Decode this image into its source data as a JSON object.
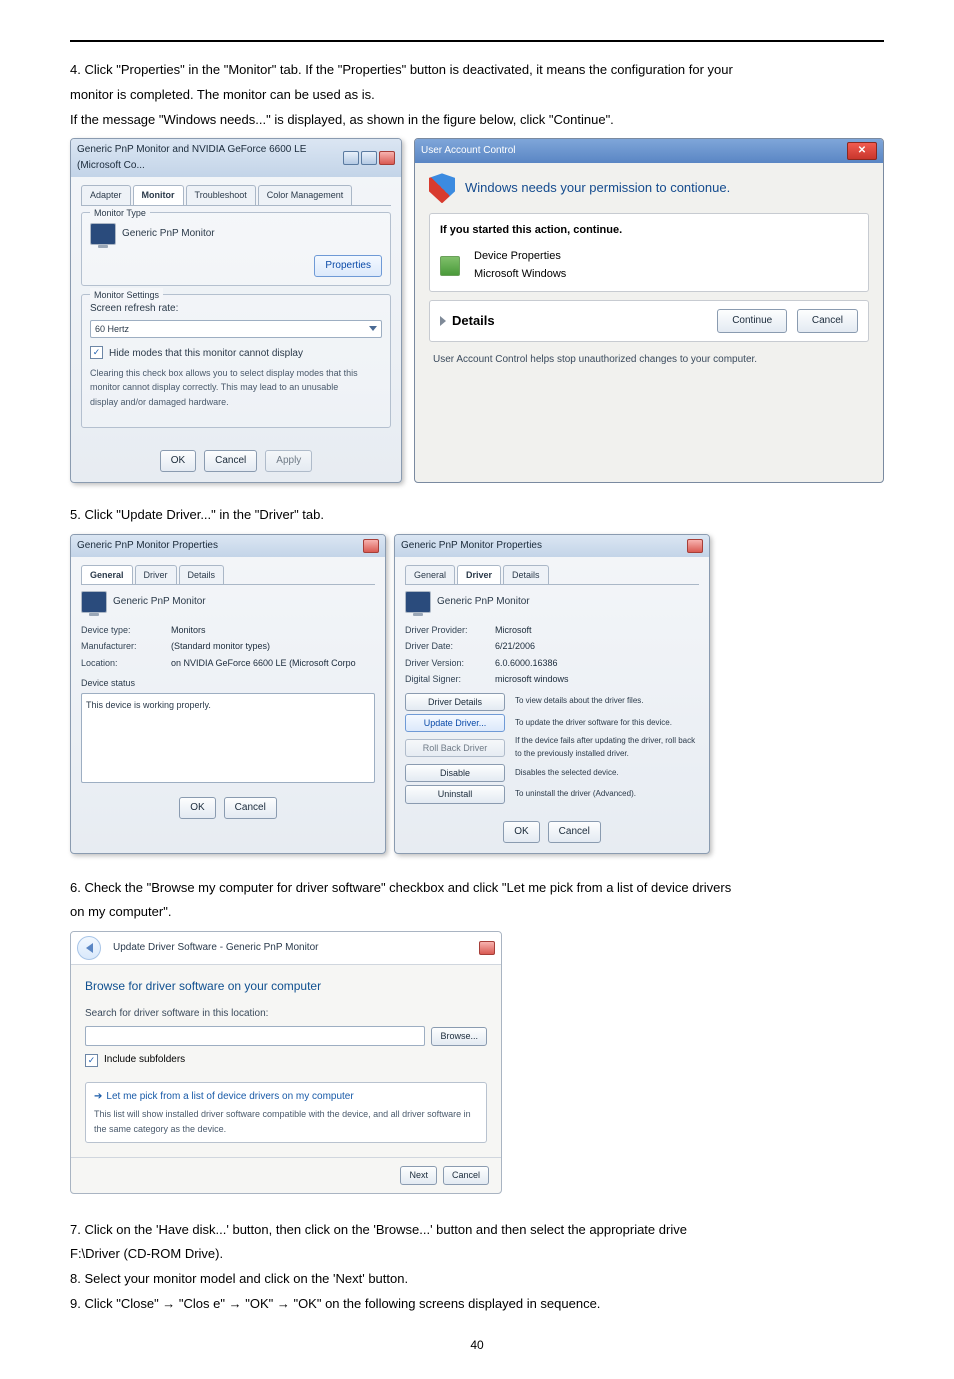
{
  "step4": {
    "line1": "4. Click \"Properties\" in the \"Monitor\" tab. If the \"Properties\" button is deactivated, it means the configuration for your",
    "line2": "monitor is completed. The monitor can be used as is.",
    "line3": "If the message \"Windows needs...\" is displayed, as shown in the figure below, click \"Continue\"."
  },
  "monA": {
    "title": "Generic PnP Monitor and NVIDIA GeForce 6600 LE (Microsoft Co...",
    "tabs": {
      "adapter": "Adapter",
      "monitor": "Monitor",
      "troubleshoot": "Troubleshoot",
      "color": "Color Management"
    },
    "type_group": "Monitor Type",
    "type_value": "Generic PnP Monitor",
    "properties_btn": "Properties",
    "settings_group": "Monitor Settings",
    "refresh_label": "Screen refresh rate:",
    "refresh_value": "60 Hertz",
    "hide_modes": "Hide modes that this monitor cannot display",
    "hide_desc1": "Clearing this check box allows you to select display modes that this",
    "hide_desc2": "monitor cannot display correctly. This may lead to an unusable",
    "hide_desc3": "display and/or damaged hardware.",
    "ok": "OK",
    "cancel": "Cancel",
    "apply": "Apply"
  },
  "uac": {
    "title": "User Account Control",
    "msg": "Windows needs your permission to contionue.",
    "action_line": "If you started this action, continue.",
    "prop": "Device Properties",
    "ms": "Microsoft Windows",
    "details": "Details",
    "continue": "Continue",
    "cancel": "Cancel",
    "footnote": "User Account Control helps stop unauthorized changes to your computer."
  },
  "step5": "5. Click \"Update Driver...\" in the \"Driver\" tab.",
  "propsL": {
    "title": "Generic PnP Monitor Properties",
    "tabs": {
      "general": "General",
      "driver": "Driver",
      "details": "Details"
    },
    "name": "Generic PnP Monitor",
    "k1": "Device type:",
    "v1": "Monitors",
    "k2": "Manufacturer:",
    "v2": "(Standard monitor types)",
    "k3": "Location:",
    "v3": "on NVIDIA GeForce 6600 LE (Microsoft Corpo",
    "status_label": "Device status",
    "status_text": "This device is working properly.",
    "ok": "OK",
    "cancel": "Cancel"
  },
  "propsR": {
    "title": "Generic PnP Monitor Properties",
    "tabs": {
      "general": "General",
      "driver": "Driver",
      "details": "Details"
    },
    "name": "Generic PnP Monitor",
    "k1": "Driver Provider:",
    "v1": "Microsoft",
    "k2": "Driver Date:",
    "v2": "6/21/2006",
    "k3": "Driver Version:",
    "v3": "6.0.6000.16386",
    "k4": "Digital Signer:",
    "v4": "microsoft windows",
    "btn_details": "Driver Details",
    "txt_details": "To view details about the driver files.",
    "btn_update": "Update Driver...",
    "txt_update": "To update the driver software for this device.",
    "btn_roll": "Roll Back Driver",
    "txt_roll": "If the device fails after updating the driver, roll back to the previously installed driver.",
    "btn_disable": "Disable",
    "txt_disable": "Disables the selected device.",
    "btn_uninstall": "Uninstall",
    "txt_uninstall": "To uninstall the driver (Advanced).",
    "ok": "OK",
    "cancel": "Cancel"
  },
  "step6": {
    "line1": "6. Check the \"Browse my computer for driver software\" checkbox and click \"Let me pick from a list of device drivers",
    "line2": "on my computer\"."
  },
  "wizard": {
    "title": "Update Driver Software - Generic PnP Monitor",
    "h": "Browse for driver software on your computer",
    "search_label": "Search for driver software in this location:",
    "browse": "Browse...",
    "include": "Include subfolders",
    "pick_title": "Let me pick from a list of device drivers on my computer",
    "pick_desc": "This list will show installed driver software compatible with the device, and all driver software in the same category as the device.",
    "next": "Next",
    "cancel": "Cancel"
  },
  "step7": {
    "line1": "7. Click on the 'Have disk...' button, then click on the 'Browse...' button and then select the appropriate drive",
    "line2": "F:\\Driver (CD-ROM Drive)."
  },
  "step8": "8. Select your monitor model and click on the 'Next' button.",
  "step9": "9. Click \"Close\"  →  \"Clos e\"  →  \"OK\"   →   \"OK\" on the following screens displayed in sequence.",
  "page_number": "40"
}
